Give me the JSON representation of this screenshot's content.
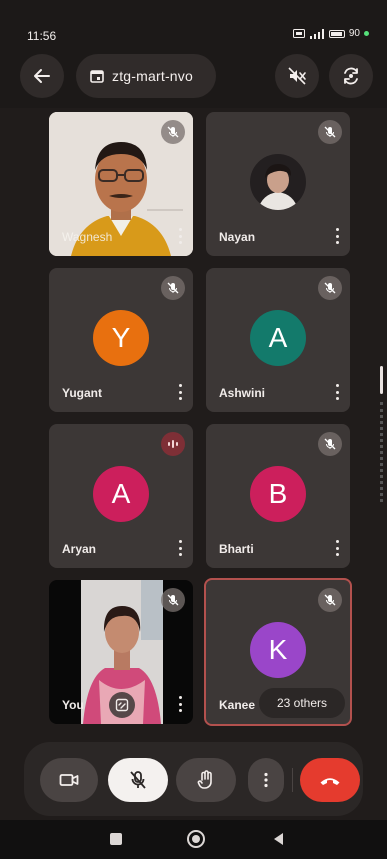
{
  "status_bar": {
    "time": "11:56",
    "battery": "90"
  },
  "header": {
    "meeting_code": "ztg-mart-nvo"
  },
  "tiles": [
    {
      "name": "Wagnesh",
      "type": "video"
    },
    {
      "name": "Nayan",
      "type": "photo"
    },
    {
      "name": "Yugant",
      "initial": "Y",
      "color": "#e8700f"
    },
    {
      "name": "Ashwini",
      "initial": "A",
      "color": "#137a6b"
    },
    {
      "name": "Aryan",
      "initial": "A",
      "color": "#cc1f5c"
    },
    {
      "name": "Bharti",
      "initial": "B",
      "color": "#cc1f5c"
    },
    {
      "name": "You",
      "type": "video"
    },
    {
      "name": "Kanee",
      "initial": "K",
      "color": "#9a46c9"
    }
  ],
  "others_label": "23 others",
  "colors": {
    "end_call": "#e53b2e",
    "background": "#201c1b",
    "tile": "#3c3736"
  },
  "icons": [
    "back-arrow-icon",
    "calendar-icon",
    "speaker-off-icon",
    "switch-camera-icon",
    "mic-off-icon",
    "camera-icon",
    "hand-icon",
    "more-vert-icon",
    "phone-hangup-icon"
  ]
}
